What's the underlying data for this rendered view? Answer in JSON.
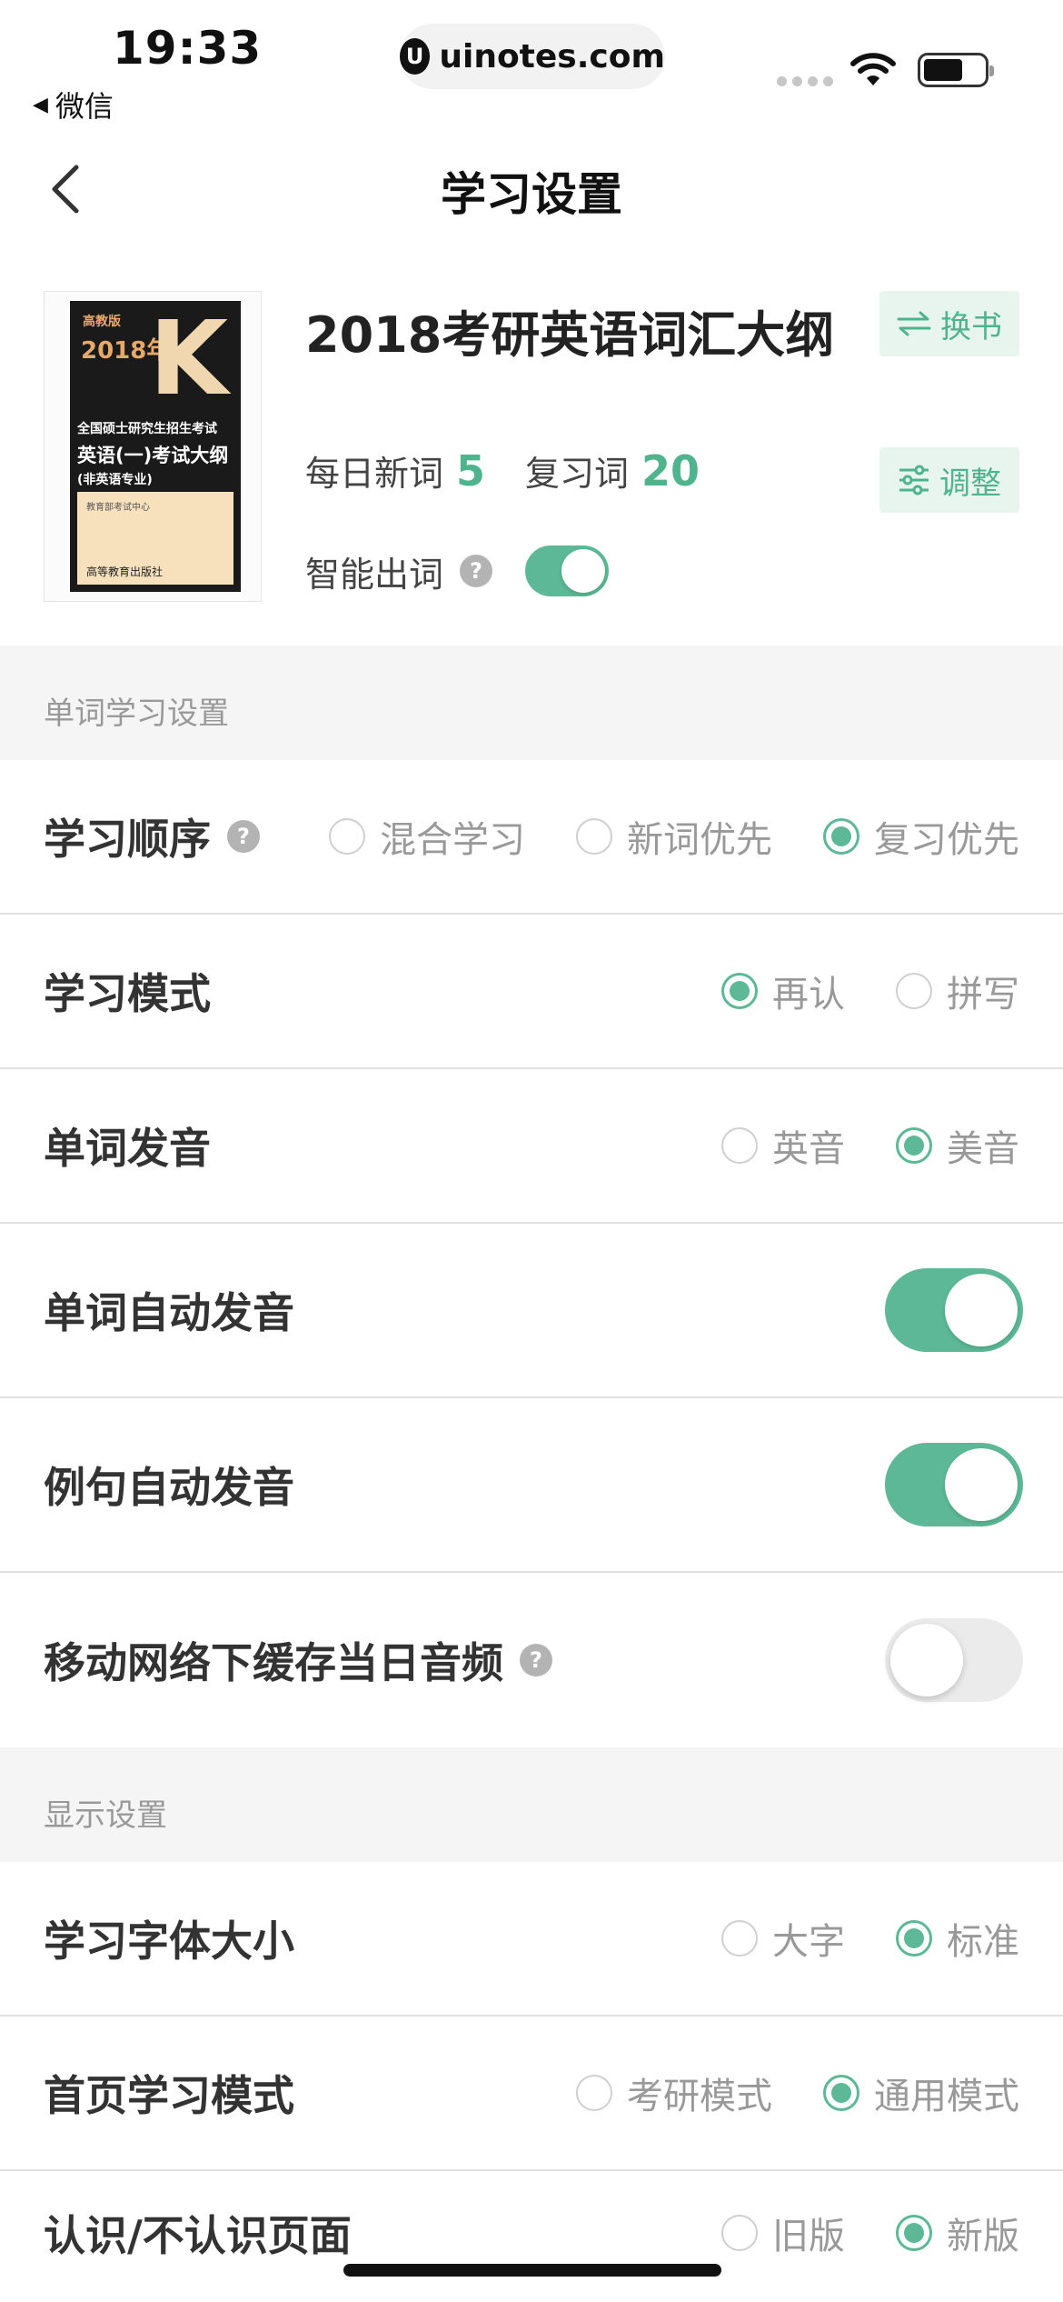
{
  "status_bar": {
    "time": "19:33",
    "back_app": "微信",
    "url": "uinotes.com",
    "url_logo": "U"
  },
  "nav": {
    "title": "学习设置"
  },
  "book": {
    "title": "2018考研英语词汇大纲",
    "swap_label": "换书",
    "adjust_label": "调整",
    "daily_new_label": "每日新词",
    "daily_new_value": "5",
    "review_label": "复习词",
    "review_value": "20",
    "smart_label": "智能出词",
    "smart_on": true,
    "cover": {
      "edition": "高教版",
      "year": "2018年",
      "letter": "K",
      "line1": "全国硕士研究生招生考试",
      "line2": "英语(一)考试大纲",
      "line3": "(非英语专业)",
      "publisher": "教育部考试中心",
      "press": "高等教育出版社"
    }
  },
  "sections": {
    "word_learning": "单词学习设置",
    "display": "显示设置"
  },
  "rows": {
    "order": {
      "label": "学习顺序",
      "options": [
        "混合学习",
        "新词优先",
        "复习优先"
      ],
      "selected": "复习优先"
    },
    "mode": {
      "label": "学习模式",
      "options": [
        "再认",
        "拼写"
      ],
      "selected": "再认"
    },
    "pronunciation": {
      "label": "单词发音",
      "options": [
        "英音",
        "美音"
      ],
      "selected": "美音"
    },
    "auto_word": {
      "label": "单词自动发音",
      "on": true
    },
    "auto_sentence": {
      "label": "例句自动发音",
      "on": true
    },
    "cache_audio": {
      "label": "移动网络下缓存当日音频",
      "on": false
    },
    "font_size": {
      "label": "学习字体大小",
      "options": [
        "大字",
        "标准"
      ],
      "selected": "标准"
    },
    "home_mode": {
      "label": "首页学习模式",
      "options": [
        "考研模式",
        "通用模式"
      ],
      "selected": "通用模式"
    },
    "known_page": {
      "label": "认识/不认识页面",
      "options": [
        "旧版",
        "新版"
      ],
      "selected": "新版"
    }
  },
  "colors": {
    "accent": "#5cb896",
    "accent_text": "#4fb48e",
    "section_bg": "#f5f5f5",
    "divider": "#e2e2e2"
  },
  "icons": {
    "back": "chevron-left-icon",
    "swap": "swap-arrows-icon",
    "adjust": "sliders-icon",
    "help": "question-circle-icon",
    "wifi": "wifi-icon",
    "battery": "battery-icon"
  }
}
